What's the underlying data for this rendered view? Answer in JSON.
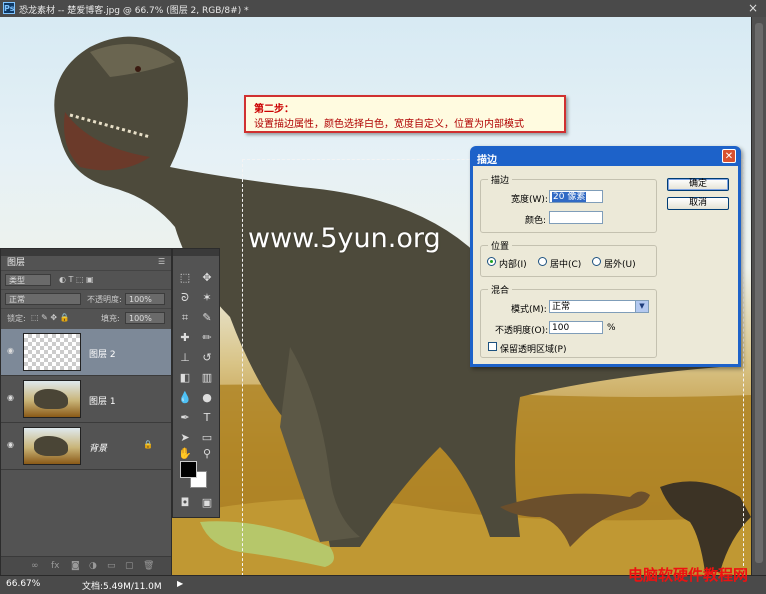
{
  "window": {
    "title": "恐龙素材 -- 楚爱博客.jpg @ 66.7% (图层 2, RGB/8#) *",
    "app_icon": "Ps",
    "close_glyph": "×"
  },
  "canvas": {
    "site_text": "www.5yun.org",
    "callout": {
      "title": "第二步：",
      "text": "设置描边属性，颜色选择白色，宽度自定义，位置为内部模式"
    }
  },
  "dialog": {
    "title": "描边",
    "close_glyph": "✕",
    "stroke_group": "描边",
    "width_label": "宽度(W):",
    "width_value": "20 像素",
    "color_label": "颜色:",
    "color_value": "#ffffff",
    "position_group": "位置",
    "positions": [
      {
        "label": "内部(I)",
        "selected": true
      },
      {
        "label": "居中(C)",
        "selected": false
      },
      {
        "label": "居外(U)",
        "selected": false
      }
    ],
    "blend_group": "混合",
    "mode_label": "模式(M):",
    "mode_value": "正常",
    "opacity_label": "不透明度(O):",
    "opacity_value": "100",
    "opacity_unit": "%",
    "preserve_label": "保留透明区域(P)",
    "preserve_checked": false,
    "ok_label": "确定",
    "cancel_label": "取消"
  },
  "layers_panel": {
    "tab": "图层",
    "filter_value": "类型",
    "blend_mode": "正常",
    "opacity_label": "不透明度:",
    "opacity_value": "100%",
    "lock_label": "锁定:",
    "fill_label": "填充:",
    "fill_value": "100%",
    "layers": [
      {
        "name": "图层 2",
        "active": true,
        "thumbnail": "transparent",
        "locked": false
      },
      {
        "name": "图层 1",
        "active": false,
        "thumbnail": "dinosaur",
        "locked": false
      },
      {
        "name": "背景",
        "active": false,
        "thumbnail": "dinosaur",
        "locked": true
      }
    ]
  },
  "status": {
    "zoom": "66.67%",
    "doc_size": "文档:5.49M/11.0M",
    "arrow": "▶"
  },
  "watermark": "电脑软硬件教程网"
}
